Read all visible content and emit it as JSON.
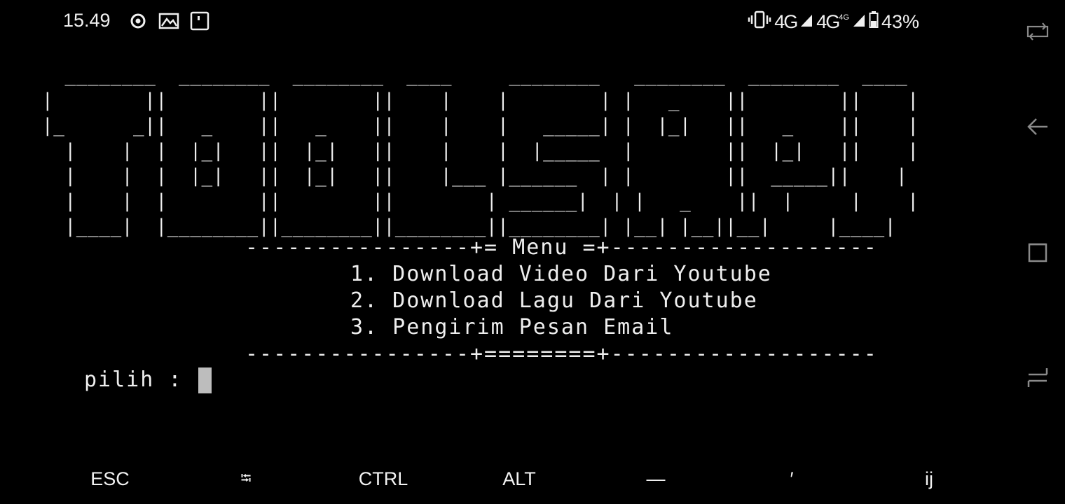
{
  "status_bar": {
    "time": "15.49",
    "left_icons": [
      "record-icon",
      "gallery-icon",
      "notification-icon"
    ],
    "network_1": "4G",
    "network_2": "4G",
    "network_2_super": "4G",
    "battery": "43%"
  },
  "terminal": {
    "banner_lines": [
      "  ________  ________  ________  ____     ________   ________  ________  ____",
      "|        ||        ||        ||    |    |        | |   _    ||        ||    |",
      "|_      _||   _    ||   _    ||    |    |   _____| |  |_|   ||   _    ||    |",
      "  |    |  |  |_|   ||  |_|   ||    |    |  |_____  |        ||  |_|   ||    |",
      "  |    |  |  |_|   ||  |_|   ||    |___ |______  | |        ||  _____||    |",
      "  |    |  |        ||        ||        | ______|  | |   _    ||  |     |    |",
      "  |____|  |________||________||________||________| |__| |__||__|     |____|"
    ],
    "menu_header": "----------------+= Menu =+-------------------",
    "menu_items": [
      "1. Download Video Dari Youtube",
      "2. Download Lagu Dari Youtube",
      "3. Pengirim Pesan Email"
    ],
    "menu_footer": "----------------+========+-------------------",
    "prompt": "pilih : "
  },
  "extra_keys": [
    "ESC",
    "⭾",
    "CTRL",
    "ALT",
    "—",
    "′",
    "ij"
  ],
  "nav_bar": [
    "rotate-icon",
    "back-icon",
    "recents-icon",
    "switch-icon"
  ]
}
